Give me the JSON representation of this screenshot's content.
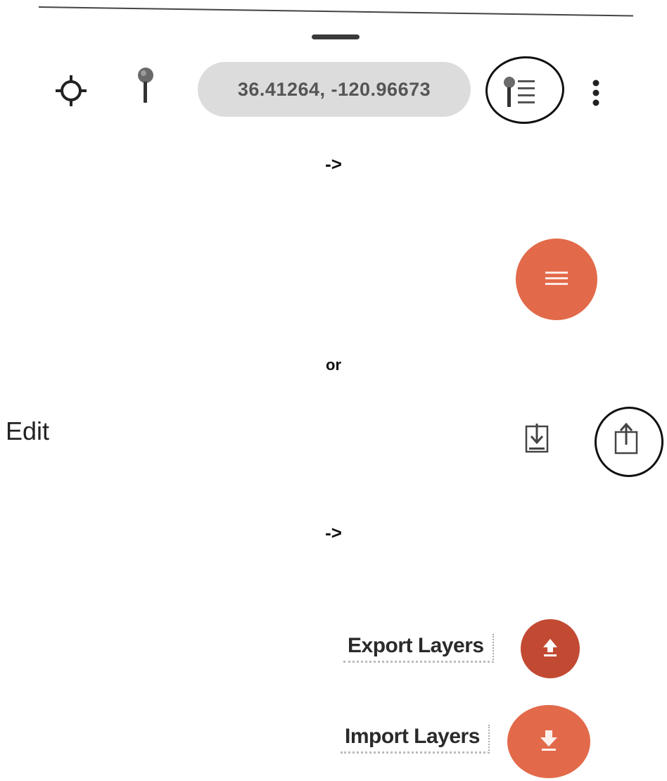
{
  "toolbar": {
    "coordinates": "36.41264, -120.96673",
    "icons": [
      "crosshair-icon",
      "map-pin-icon",
      "pin-list-icon",
      "more-vert-icon"
    ]
  },
  "annotations": {
    "arrow_1": "->",
    "or": "or",
    "arrow_2": "->"
  },
  "fab_menu": {
    "icon": "menu-icon",
    "color": "#e26a4a"
  },
  "edit_bar": {
    "title": "Edit",
    "icons": [
      "import-icon",
      "export-icon"
    ]
  },
  "layer_actions": [
    {
      "label": "Export Layers",
      "icon": "upload-arrow-icon",
      "color": "#c24a32"
    },
    {
      "label": "Import Layers",
      "icon": "download-arrow-icon",
      "color": "#e26a4a"
    }
  ]
}
